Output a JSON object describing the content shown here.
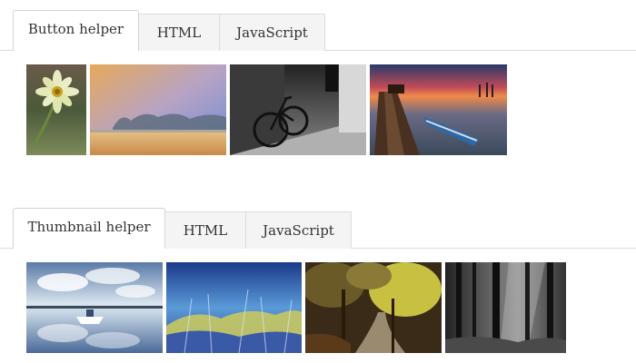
{
  "sections": [
    {
      "tabs": [
        {
          "label": "Button helper",
          "active": true
        },
        {
          "label": "HTML",
          "active": false
        },
        {
          "label": "JavaScript",
          "active": false
        }
      ],
      "thumbnails": [
        {
          "subject": "yellow daisy flower"
        },
        {
          "subject": "misty lake at sunrise"
        },
        {
          "subject": "bicycle on cobblestone street (black and white)"
        },
        {
          "subject": "wooden pier and boat at sunset"
        }
      ]
    },
    {
      "tabs": [
        {
          "label": "Thumbnail helper",
          "active": true
        },
        {
          "label": "HTML",
          "active": false
        },
        {
          "label": "JavaScript",
          "active": false
        }
      ],
      "thumbnails": [
        {
          "subject": "boat on reflective lake with clouds"
        },
        {
          "subject": "blue sky with yellow grass"
        },
        {
          "subject": "autumn forest path"
        },
        {
          "subject": "dark forest with sunbeams (black and white)"
        }
      ]
    }
  ]
}
